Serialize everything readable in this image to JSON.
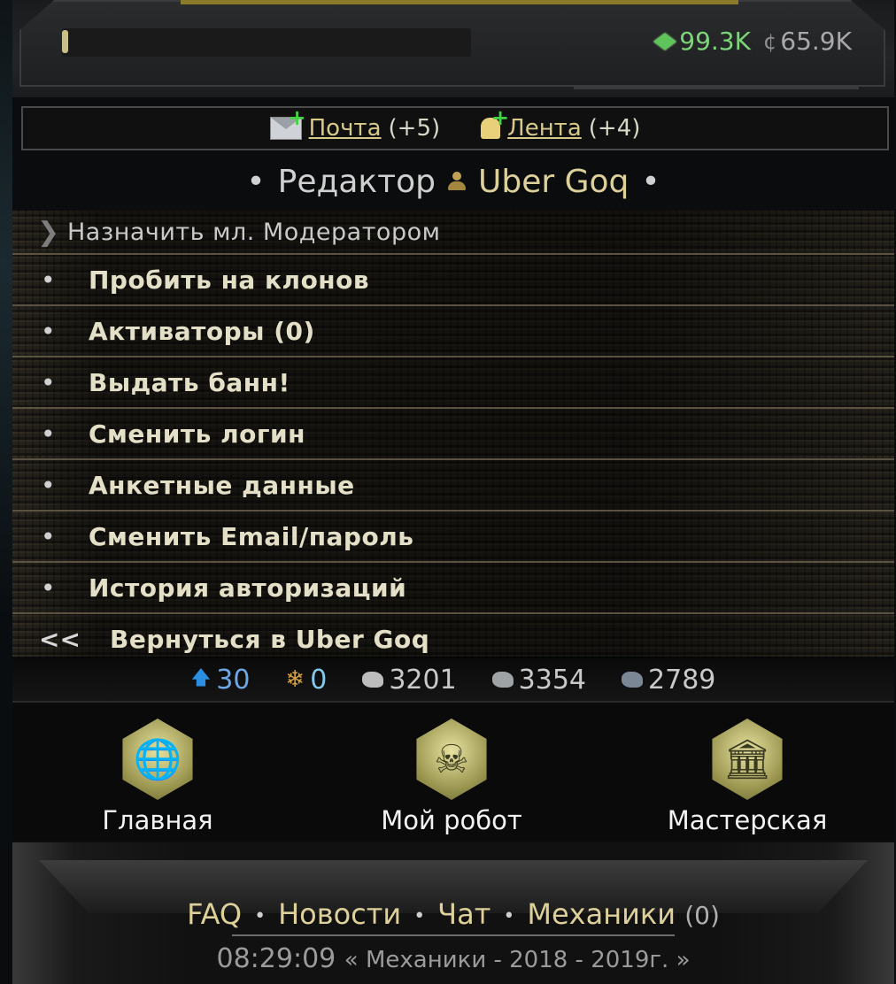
{
  "hud": {
    "gems": "99.3K",
    "credits": "65.9K"
  },
  "notifications": {
    "mail_label": "Почта",
    "mail_count": "(+5)",
    "feed_label": "Лента",
    "feed_count": "(+4)"
  },
  "title": {
    "role": "Редактор",
    "username": "Uber Goq",
    "dot_left": "•",
    "dot_right": "•"
  },
  "menu": {
    "header": "Назначить мл. Модератором",
    "items": [
      "Пробить на клонов",
      "Активаторы (0)",
      "Выдать банн!",
      "Сменить логин",
      "Анкетные данные",
      "Сменить Email/пароль",
      "История авторизаций"
    ],
    "bullet": "•",
    "back_arrow": "<<",
    "back_label": "Вернуться в Uber Goq"
  },
  "stats": {
    "level": "30",
    "snowflakes": "0",
    "ore1": "3201",
    "ore2": "3354",
    "ore3": "2789"
  },
  "nav": {
    "home": "Главная",
    "robot": "Мой робот",
    "workshop": "Мастерская"
  },
  "footer": {
    "faq": "FAQ",
    "news": "Новости",
    "chat": "Чат",
    "mechanics": "Механики",
    "mechanics_count": "(0)",
    "time": "08:29:09",
    "copyright": "« Механики - 2018 - 2019г. »"
  },
  "colors": {
    "accent_gold": "#ddd09a",
    "gem_green": "#7ed47a",
    "level_blue": "#6fa7e4"
  }
}
